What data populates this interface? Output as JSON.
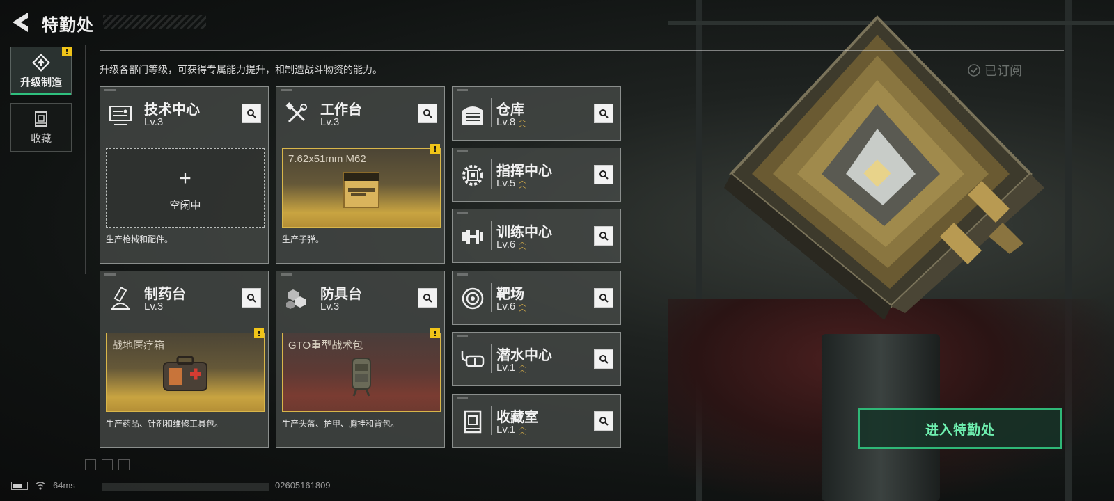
{
  "header": {
    "title": "特勤处",
    "subtitle": "升级各部门等级，可获得专属能力提升，和制造战斗物资的能力。",
    "subscribed_label": "已订阅"
  },
  "sidebar": {
    "tabs": [
      {
        "label": "升级制造",
        "icon": "upgrade-craft-icon",
        "active": true,
        "alert": "!"
      },
      {
        "label": "收藏",
        "icon": "collection-icon",
        "active": false
      }
    ]
  },
  "departments": [
    {
      "name": "技术中心",
      "level": "Lv.3",
      "icon": "tech-center-icon",
      "slot": {
        "state": "idle",
        "plus": "+",
        "idle_label": "空闲中"
      },
      "description": "生产枪械和配件。"
    },
    {
      "name": "工作台",
      "level": "Lv.3",
      "icon": "workbench-icon",
      "slot": {
        "state": "producing",
        "item": "7.62x51mm M62",
        "alert": "!"
      },
      "description": "生产子弹。"
    },
    {
      "name": "制药台",
      "level": "Lv.3",
      "icon": "pharmacy-icon",
      "slot": {
        "state": "producing",
        "item": "战地医疗箱",
        "alert": "!"
      },
      "description": "生产药品、针剂和维修工具包。"
    },
    {
      "name": "防具台",
      "level": "Lv.3",
      "icon": "armor-bench-icon",
      "slot": {
        "state": "producing",
        "item": "GTO重型战术包",
        "alert": "!"
      },
      "description": "生产头盔、护甲、胸挂和背包。"
    },
    {
      "name": "仓库",
      "level": "Lv.8",
      "icon": "warehouse-icon",
      "upgradable": true
    },
    {
      "name": "指挥中心",
      "level": "Lv.5",
      "icon": "command-center-icon",
      "upgradable": true
    },
    {
      "name": "训练中心",
      "level": "Lv.6",
      "icon": "training-center-icon",
      "upgradable": true
    },
    {
      "name": "靶场",
      "level": "Lv.6",
      "icon": "shooting-range-icon",
      "upgradable": true
    },
    {
      "name": "潜水中心",
      "level": "Lv.1",
      "icon": "diving-center-icon",
      "upgradable": true
    },
    {
      "name": "收藏室",
      "level": "Lv.1",
      "icon": "collection-room-icon",
      "upgradable": true
    }
  ],
  "enter_button": "进入特勤处",
  "status": {
    "ping": "64ms",
    "uid": "02605161809"
  },
  "colors": {
    "accent_green": "#2fb777",
    "alert_yellow": "#f0c419",
    "slot_gold": "#c9a441"
  }
}
